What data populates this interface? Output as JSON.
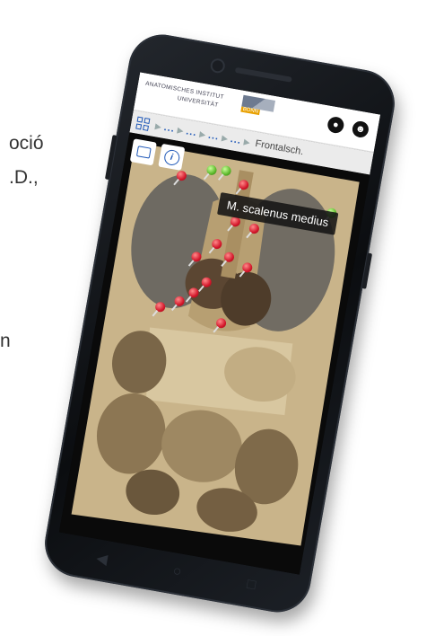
{
  "background_fragments": [
    "oció",
    ".D.,",
    "n"
  ],
  "header": {
    "institute_line1": "ANATOMISCHES INSTITUT",
    "institute_line2": "UNIVERSITÄT",
    "institute_badge": "BONN",
    "globe_icon": "globe-icon",
    "user_icon": "user-icon"
  },
  "breadcrumb": {
    "home_icon": "grid-icon",
    "items": [
      "...",
      "...",
      "...",
      "..."
    ],
    "current": "Frontalsch."
  },
  "viewer": {
    "tooltip": "M. scalenus medius",
    "buttons": {
      "comment_icon": "comment-icon",
      "info_icon": "info-icon"
    }
  },
  "colors": {
    "accent": "#1f58b8",
    "pin_red": "#d3162a",
    "pin_green": "#5cb82b",
    "badge": "#e8a000"
  }
}
